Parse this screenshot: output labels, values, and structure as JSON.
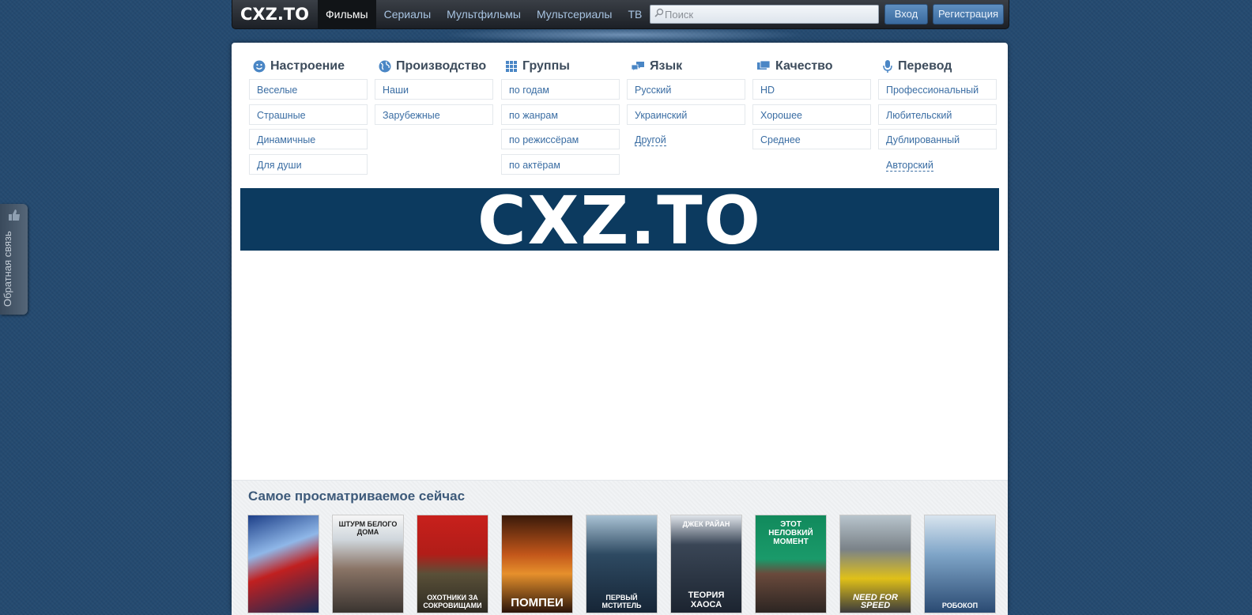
{
  "header": {
    "logo": "CXZ.TO",
    "nav": [
      "Фильмы",
      "Сериалы",
      "Мультфильмы",
      "Мультсериалы",
      "ТВ"
    ],
    "active_nav": "Фильмы",
    "search_placeholder": "Поиск",
    "login_label": "Вход",
    "register_label": "Регистрация"
  },
  "categories": [
    {
      "icon": "smiley-icon",
      "title": "Настроение",
      "links": [
        "Веселые",
        "Страшные",
        "Динамичные",
        "Для души"
      ]
    },
    {
      "icon": "globe-icon",
      "title": "Производство",
      "links": [
        "Наши",
        "Зарубежные"
      ]
    },
    {
      "icon": "grid-icon",
      "title": "Группы",
      "links": [
        "по годам",
        "по жанрам",
        "по режиссёрам",
        "по актёрам"
      ]
    },
    {
      "icon": "speech-bubbles-icon",
      "title": "Язык",
      "links": [
        "Русский",
        "Украинский"
      ],
      "extra": "Другой"
    },
    {
      "icon": "screen-icon",
      "title": "Качество",
      "links": [
        "HD",
        "Хорошее",
        "Среднее"
      ]
    },
    {
      "icon": "microphone-icon",
      "title": "Перевод",
      "links": [
        "Профессиональный",
        "Любительский",
        "Дублированный"
      ],
      "extra": "Авторский"
    }
  ],
  "banner": {
    "text": "CXZ.TO",
    "color": "#0c3a5f"
  },
  "popular": {
    "title": "Самое просматриваемое сейчас",
    "posters": [
      {
        "top": "",
        "caption": ""
      },
      {
        "top": "ШТУРМ БЕЛОГО ДОМА",
        "caption": ""
      },
      {
        "top": "",
        "caption": "ОХОТНИКИ ЗА СОКРОВИЩАМИ"
      },
      {
        "top": "",
        "caption": "ПОМПЕИ"
      },
      {
        "top": "",
        "caption": "ПЕРВЫЙ МСТИТЕЛЬ"
      },
      {
        "top": "ДЖЕК РАЙАН",
        "caption": "ТЕОРИЯ ХАОСА"
      },
      {
        "top": "ЭТОТ НЕЛОВКИЙ МОМЕНТ",
        "caption": ""
      },
      {
        "top": "",
        "caption": "NEED FOR SPEED"
      },
      {
        "top": "",
        "caption": "РОБОКОП"
      }
    ]
  },
  "feedback": {
    "label": "Обратная связь"
  }
}
